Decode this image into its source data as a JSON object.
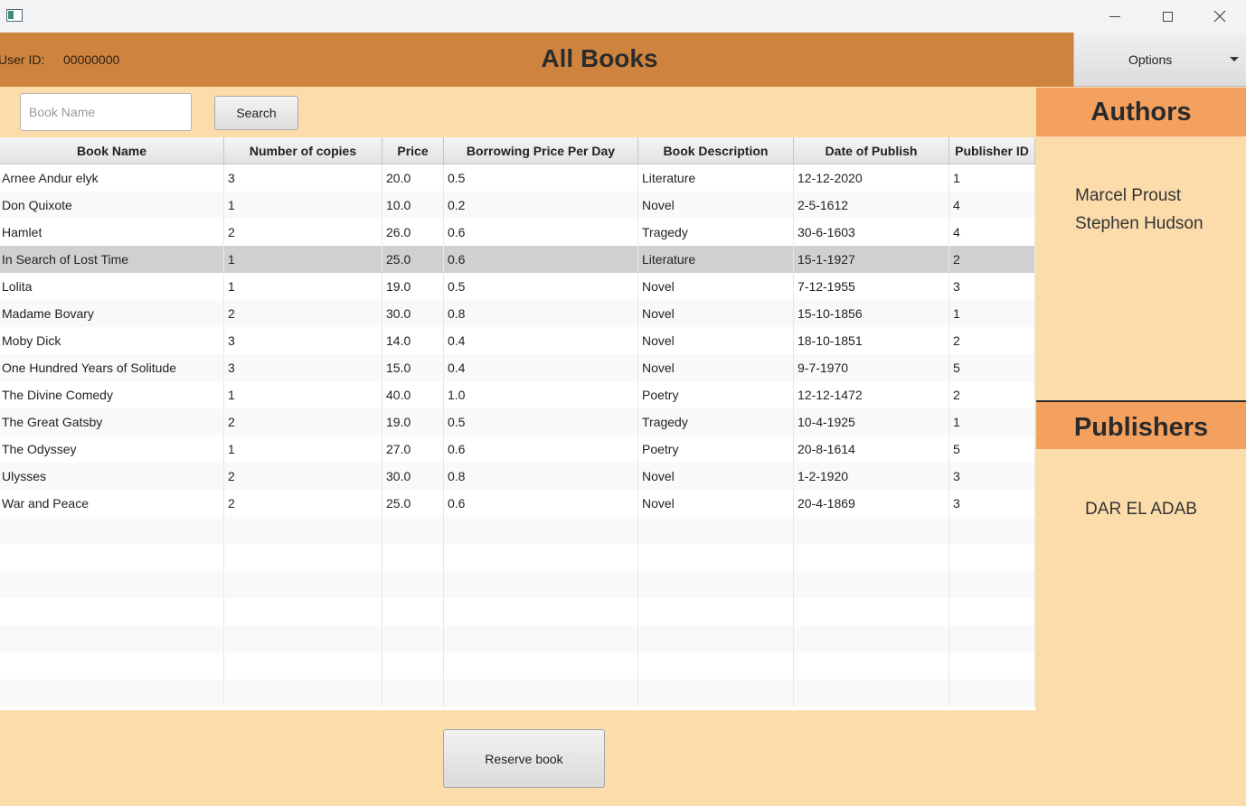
{
  "header": {
    "user_id_label": "User ID:",
    "user_id_value": "00000000",
    "title": "All Books",
    "options_label": "Options"
  },
  "search": {
    "placeholder": "Book Name",
    "value": "",
    "button_label": "Search"
  },
  "table": {
    "columns": [
      "Book Name",
      "Number of copies",
      "Price",
      "Borrowing Price Per Day",
      "Book Description",
      "Date of Publish",
      "Publisher ID"
    ],
    "selected_row": 3,
    "rows": [
      [
        "Arnee Andur elyk",
        "3",
        "20.0",
        "0.5",
        "Literature",
        "12-12-2020",
        "1"
      ],
      [
        "Don Quixote",
        "1",
        "10.0",
        "0.2",
        "Novel",
        "2-5-1612",
        "4"
      ],
      [
        "Hamlet",
        "2",
        "26.0",
        "0.6",
        "Tragedy",
        "30-6-1603",
        "4"
      ],
      [
        "In Search of Lost Time",
        "1",
        "25.0",
        "0.6",
        "Literature",
        "15-1-1927",
        "2"
      ],
      [
        "Lolita",
        "1",
        "19.0",
        "0.5",
        "Novel",
        "7-12-1955",
        "3"
      ],
      [
        "Madame Bovary",
        "2",
        "30.0",
        "0.8",
        "Novel",
        "15-10-1856",
        "1"
      ],
      [
        "Moby Dick",
        "3",
        "14.0",
        "0.4",
        "Novel",
        "18-10-1851",
        "2"
      ],
      [
        "One Hundred Years of Solitude",
        "3",
        "15.0",
        "0.4",
        "Novel",
        "9-7-1970",
        "5"
      ],
      [
        "The Divine Comedy",
        "1",
        "40.0",
        "1.0",
        "Poetry",
        "12-12-1472",
        "2"
      ],
      [
        "The Great Gatsby",
        "2",
        "19.0",
        "0.5",
        "Tragedy",
        "10-4-1925",
        "1"
      ],
      [
        "The Odyssey",
        "1",
        "27.0",
        "0.6",
        "Poetry",
        "20-8-1614",
        "5"
      ],
      [
        "Ulysses",
        "2",
        "30.0",
        "0.8",
        "Novel",
        "1-2-1920",
        "3"
      ],
      [
        "War and Peace",
        "2",
        "25.0",
        "0.6",
        "Novel",
        "20-4-1869",
        "3"
      ]
    ]
  },
  "reserve_label": "Reserve book",
  "authors": {
    "title": "Authors",
    "items": [
      "Marcel Proust",
      "Stephen Hudson"
    ]
  },
  "publishers": {
    "title": "Publishers",
    "items": [
      "DAR EL ADAB"
    ]
  },
  "colors": {
    "background": "#fddcac",
    "header": "#ce843f",
    "side_header": "#f4a05e",
    "selected_row": "#d0d0d0"
  }
}
